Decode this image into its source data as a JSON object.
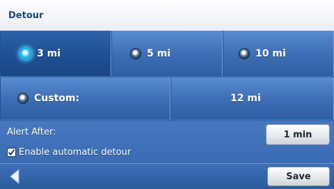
{
  "header": {
    "title": "Detour"
  },
  "distance_options": [
    {
      "label": "3 mi",
      "selected": true
    },
    {
      "label": "5 mi",
      "selected": false
    },
    {
      "label": "10 mi",
      "selected": false
    }
  ],
  "custom": {
    "label": "Custom:",
    "value": "12 mi",
    "selected": false
  },
  "alert": {
    "label": "Alert After:",
    "button_label": "1 min"
  },
  "auto_detour": {
    "label": "Enable automatic detour",
    "checked": true
  },
  "footer": {
    "save_label": "Save"
  },
  "colors": {
    "panel": "#3a6bb2",
    "header_title": "#1b4778",
    "radio_selected_glow": "#3fd3ff"
  }
}
